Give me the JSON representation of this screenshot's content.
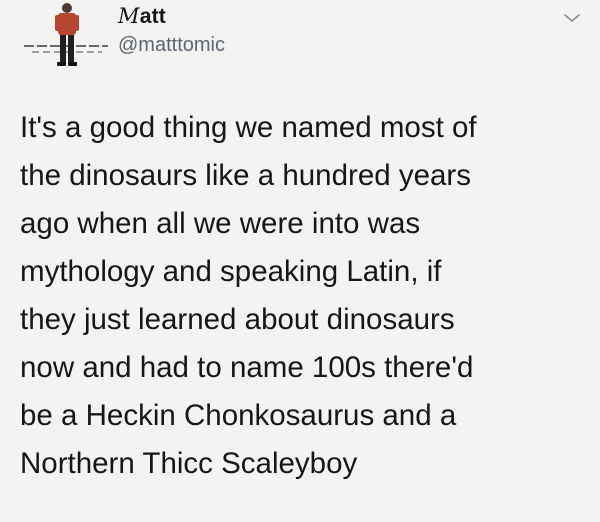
{
  "author": {
    "display_name_prefix": "M",
    "display_name_rest": "att",
    "handle": "@matttomic",
    "avatar_icon": "avatar-figure-icon"
  },
  "menu": {
    "icon": "chevron-down-icon"
  },
  "tweet": {
    "lines": [
      "It's a good thing we named most of",
      "the dinosaurs like a hundred years",
      "ago when all we were into was",
      "mythology and speaking Latin, if",
      "they just learned about dinosaurs",
      "now and had to name 100s there'd",
      "be a Heckin Chonkosaurus and a",
      "Northern Thicc Scaleyboy"
    ]
  },
  "colors": {
    "background": "#f3f3f1",
    "text": "#161616",
    "handle": "#5b6670",
    "avatar_shirt": "#b5462f"
  }
}
